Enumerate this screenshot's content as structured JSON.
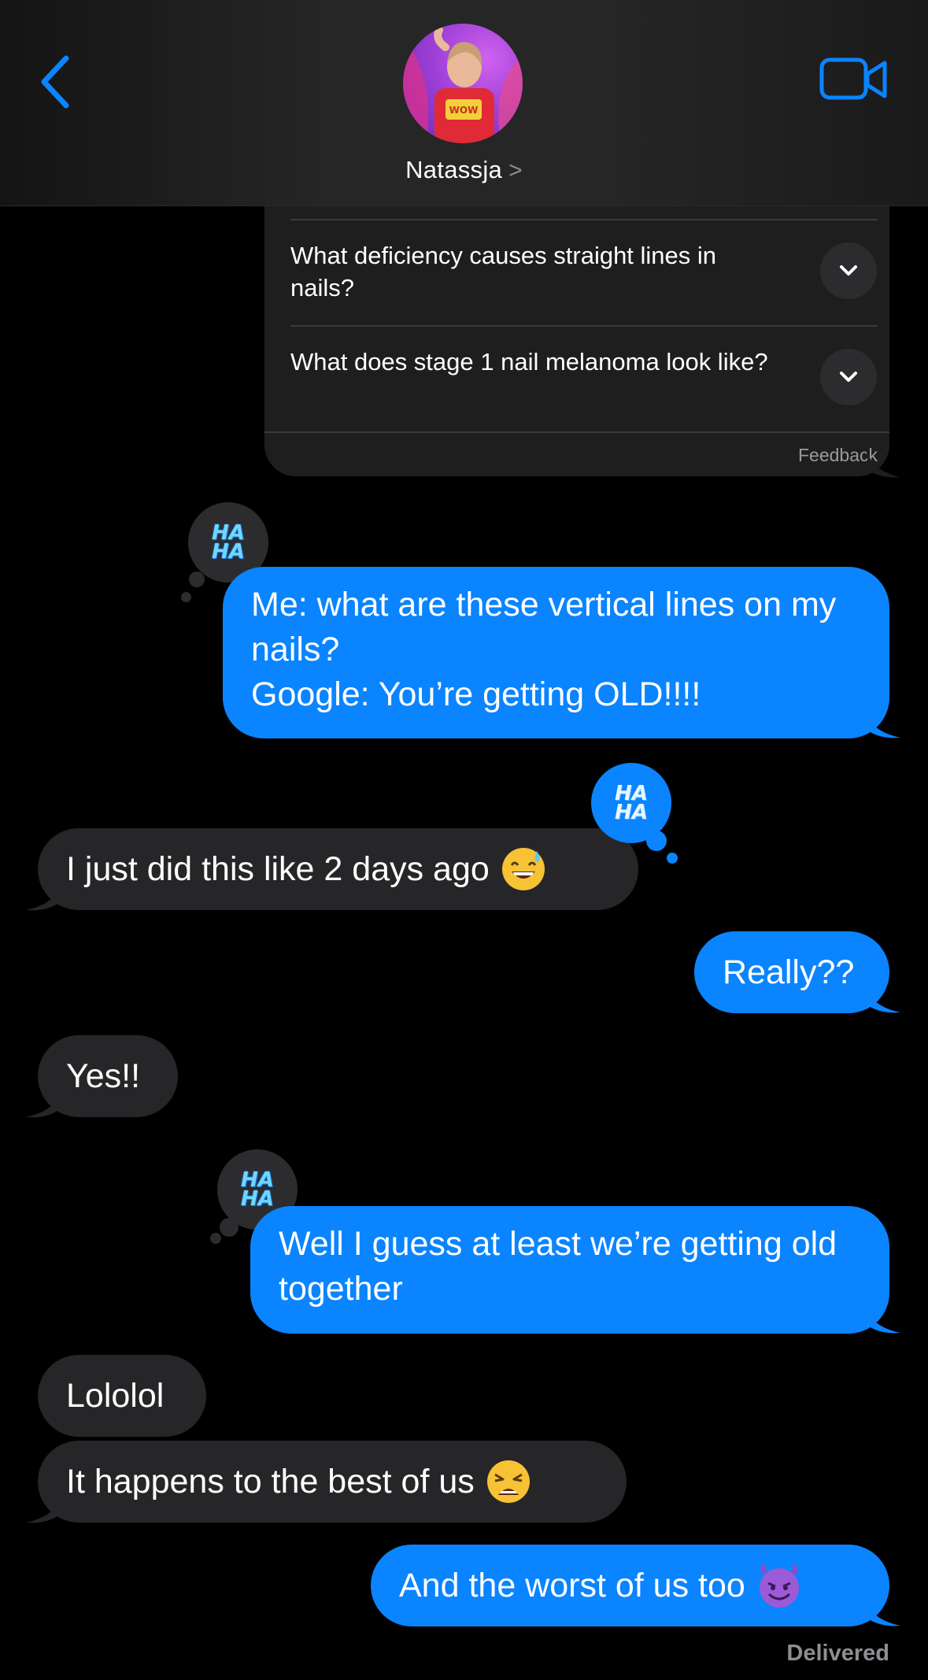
{
  "header": {
    "contact_name": "Natassja",
    "name_chevron": ">",
    "back_icon": "chevron-left-icon",
    "video_icon": "video-camera-icon",
    "accent_color": "#0a84ff"
  },
  "card": {
    "faqs": [
      "What deficiency causes straight lines in nails?",
      "What does stage 1 nail melanoma look like?"
    ],
    "expand_icon": "chevron-down-icon",
    "feedback_label": "Feedback"
  },
  "messages": {
    "m1": "Me: what are these vertical lines on my nails?\nGoogle: You’re getting OLD!!!!",
    "m2": "I just did this like 2 days ago",
    "m2_emoji": "grinning-sweat-emoji",
    "m3": "Really??",
    "m4": "Yes!!",
    "m5": "Well I guess at least we’re getting old together",
    "m6": "Lololol",
    "m7": "It happens to the best of us",
    "m7_emoji": "weary-face-emoji",
    "m8": "And the worst of us too",
    "m8_emoji": "smiling-devil-emoji"
  },
  "tapbacks": {
    "line1": "HA",
    "line2": "HA"
  },
  "status": {
    "delivered": "Delivered"
  },
  "colors": {
    "sent_bubble": "#0a84ff",
    "received_bubble": "#262628",
    "background": "#000000"
  }
}
